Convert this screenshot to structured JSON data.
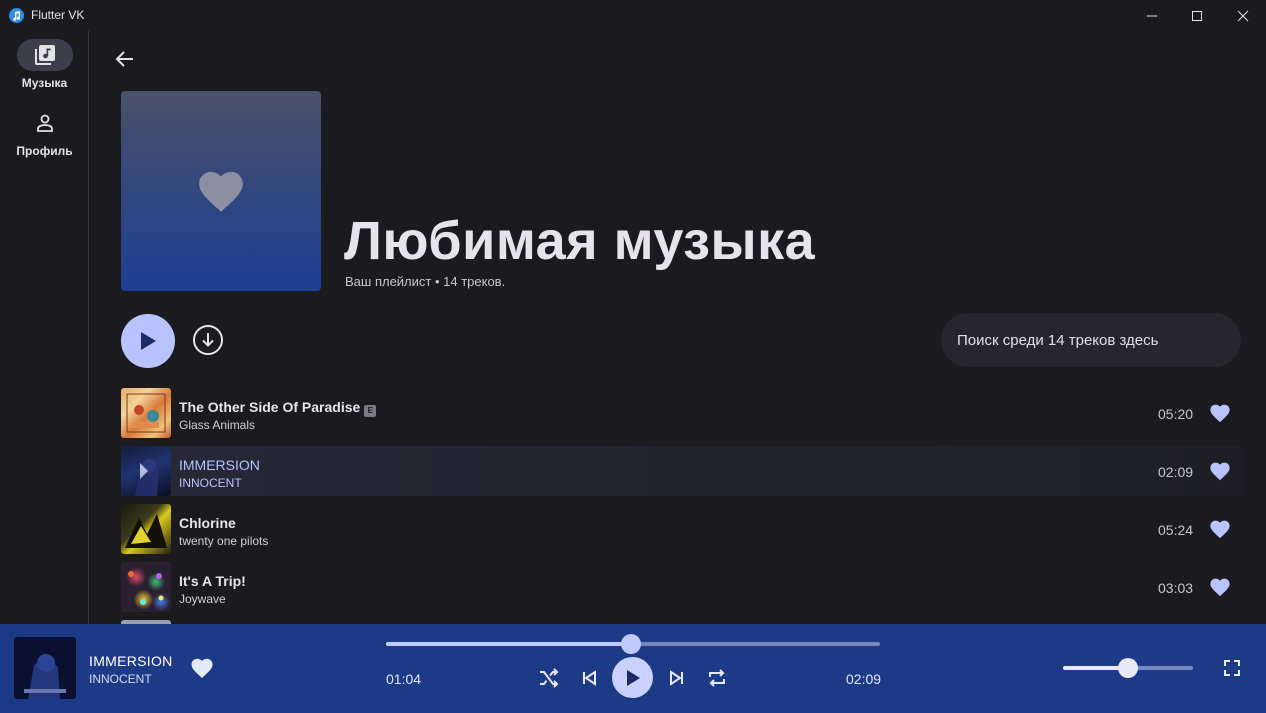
{
  "window": {
    "title": "Flutter VK",
    "controls": [
      "minimize-icon",
      "maximize-icon",
      "close-icon"
    ]
  },
  "sidebar": {
    "items": [
      {
        "label": "Музыка",
        "icon": "music-library-icon",
        "active": true
      },
      {
        "label": "Профиль",
        "icon": "person-icon",
        "active": false
      }
    ]
  },
  "playlist": {
    "title": "Любимая музыка",
    "subtitle": "Ваш плейлист • 14 треков.",
    "cover_icon": "heart-icon"
  },
  "search": {
    "placeholder": "Поиск среди 14 треков здесь"
  },
  "tracks": [
    {
      "title": "The Other Side Of Paradise",
      "artist": "Glass Animals",
      "duration": "05:20",
      "explicit": true,
      "liked": true,
      "playing": false
    },
    {
      "title": "IMMERSION",
      "artist": "INNOCENT",
      "duration": "02:09",
      "explicit": false,
      "liked": true,
      "playing": true
    },
    {
      "title": "Chlorine",
      "artist": "twenty one pilots",
      "duration": "05:24",
      "explicit": false,
      "liked": true,
      "playing": false
    },
    {
      "title": "It's A Trip!",
      "artist": "Joywave",
      "duration": "03:03",
      "explicit": false,
      "liked": true,
      "playing": false
    }
  ],
  "player": {
    "title": "IMMERSION",
    "artist": "INNOCENT",
    "current_time": "01:04",
    "total_time": "02:09",
    "progress": 0.496,
    "volume": 0.5,
    "liked": true
  },
  "colors": {
    "accent": "#b9c3ff",
    "player_bg": "#1d3a87",
    "background": "#1b1b1f"
  }
}
